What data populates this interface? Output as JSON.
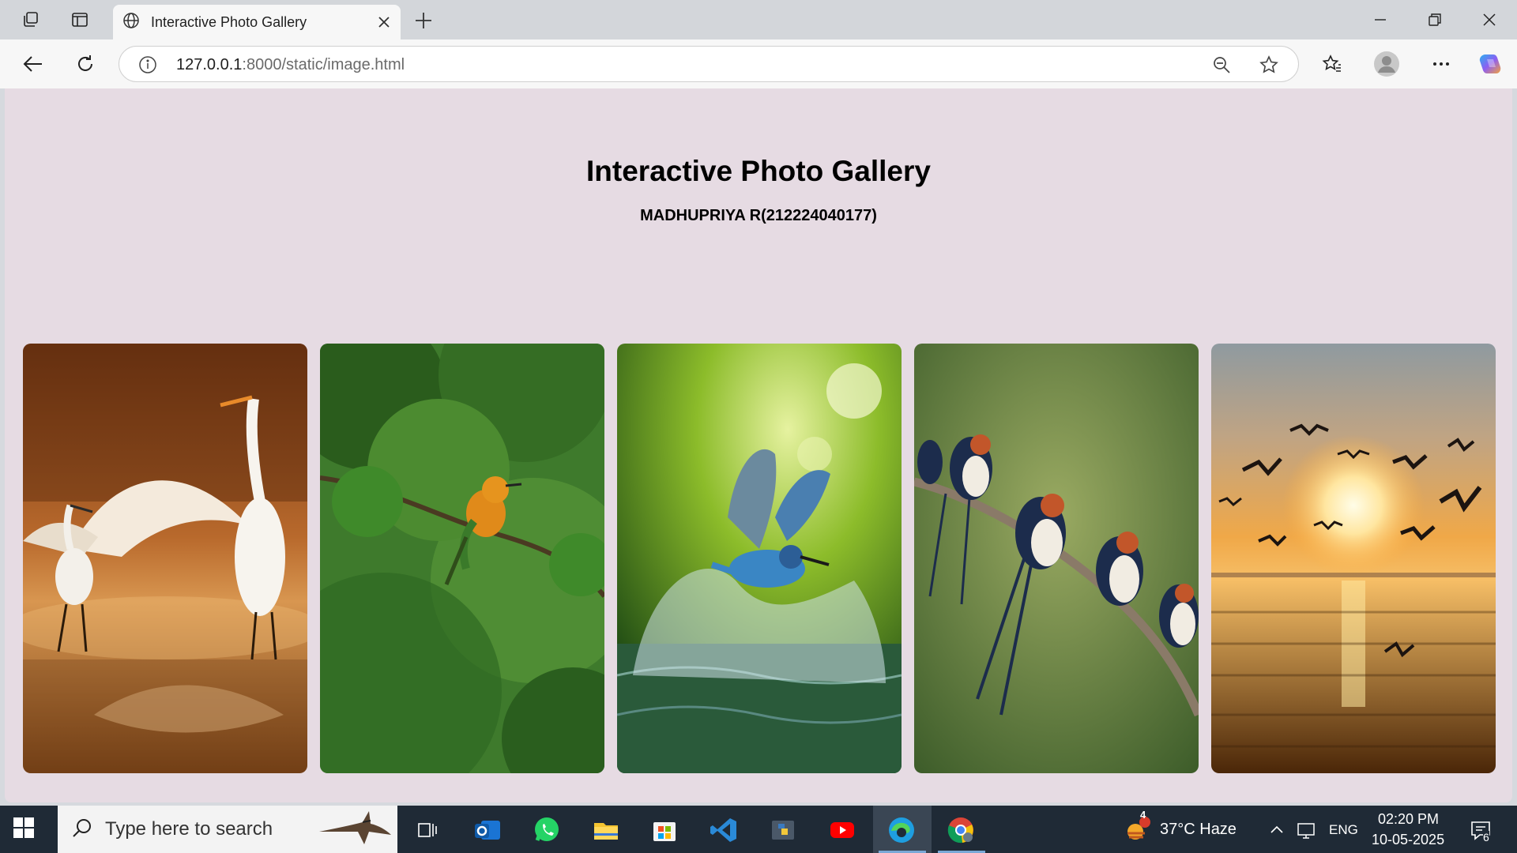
{
  "browser": {
    "tab_title": "Interactive Photo Gallery",
    "url_host": "127.0.0.1",
    "url_path": ":8000/static/image.html"
  },
  "page": {
    "title": "Interactive Photo Gallery",
    "subtitle": "MADHUPRIYA R(212224040177)",
    "background_color": "#e6dbe3",
    "photos": [
      {
        "subject": "egrets"
      },
      {
        "subject": "bee-eater"
      },
      {
        "subject": "kingfisher"
      },
      {
        "subject": "swallows"
      },
      {
        "subject": "birds-sunset"
      }
    ]
  },
  "taskbar": {
    "search_placeholder": "Type here to search",
    "weather_badge": "4",
    "weather": "37°C  Haze",
    "language": "ENG",
    "time": "02:20 PM",
    "date": "10-05-2025",
    "notifications": "6"
  }
}
